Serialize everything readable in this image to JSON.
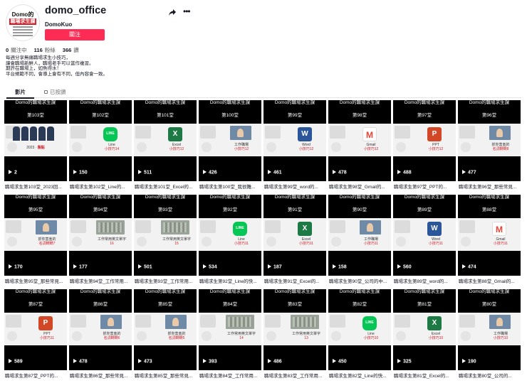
{
  "profile": {
    "username": "domo_office",
    "nickname": "DomoKuo",
    "follow_label": "關注",
    "avatar_title": "Domo的",
    "avatar_subtitle": "職場求生課"
  },
  "stats": [
    {
      "value": "0",
      "label": "關注中"
    },
    {
      "value": "116",
      "label": "粉絲"
    },
    {
      "value": "366",
      "label": "讚"
    }
  ],
  "bio": [
    "每週分享無痛職場求生小技巧，",
    "讓會職場新鮮人，職場老手可以當作複習。",
    "期許在職場上，如魚得水！",
    "平台規範不同，會導上會有不同，但內容會一致。"
  ],
  "tabs": {
    "videos": "影片",
    "liked": "已按讚"
  },
  "icon_names": {
    "share": "share-icon",
    "more": "more-icon",
    "play": "play-icon",
    "lock": "lock-icon"
  },
  "colors": {
    "follow": "#fe2c55",
    "accent_red": "#d2202a"
  },
  "brand": "Domo的職場求生課",
  "videos": [
    {
      "ep": "第103堂",
      "views": "2",
      "icon": "group",
      "label": "2023",
      "label2": "盤點",
      "caption": "職場求生第103堂_2023回..."
    },
    {
      "ep": "第102堂",
      "views": "150",
      "icon": "line",
      "label": "Line",
      "label2": "小技巧14",
      "caption": "職場求生第102堂_Line的..."
    },
    {
      "ep": "第101堂",
      "views": "511",
      "icon": "excel",
      "label": "Excel",
      "label2": "小技巧12",
      "caption": "職場求生第101堂_Excel的..."
    },
    {
      "ep": "第100堂",
      "views": "426",
      "icon": "photo",
      "label": "工作職場",
      "label2": "小技巧12",
      "caption": "職場求生第100堂_我很難..."
    },
    {
      "ep": "第99堂",
      "views": "461",
      "icon": "word",
      "label": "Word",
      "label2": "小技巧12",
      "caption": "職場求生第99堂_word的..."
    },
    {
      "ep": "第98堂",
      "views": "478",
      "icon": "gmail",
      "label": "Gmail",
      "label2": "小技巧12",
      "caption": "職場求生第98堂_Gmail的..."
    },
    {
      "ep": "第97堂",
      "views": "488",
      "icon": "ppt",
      "label": "PPT",
      "label2": "小技巧12",
      "caption": "職場求生第97堂_PPT的..."
    },
    {
      "ep": "第96堂",
      "views": "477",
      "icon": "photo",
      "label": "抓你害羞的",
      "label2": "名詞轉轉8",
      "caption": "職場求生第96堂_那些常見..."
    },
    {
      "ep": "第95堂",
      "views": "170",
      "icon": "photo",
      "label": "抓你害羞的",
      "label2": "名詞轉轉7",
      "caption": "職場求生第95堂_那些常見..."
    },
    {
      "ep": "第94堂",
      "views": "177",
      "icon": "office",
      "label": "工作常用英文單字",
      "label2": "16",
      "caption": "職場求生第94堂_工作常用..."
    },
    {
      "ep": "第93堂",
      "views": "501",
      "icon": "office",
      "label": "工作常用英文單字",
      "label2": "15",
      "caption": "職場求生第93堂_工作常用..."
    },
    {
      "ep": "第92堂",
      "views": "534",
      "icon": "line",
      "label": "Line",
      "label2": "小技巧11",
      "caption": "職場求生第92堂_Line的快..."
    },
    {
      "ep": "第91堂",
      "views": "187",
      "icon": "excel",
      "label": "Excel",
      "label2": "小技巧11",
      "caption": "職場求生第91堂_Excel的..."
    },
    {
      "ep": "第90堂",
      "views": "158",
      "icon": "photo",
      "label": "工作職場",
      "label2": "小技巧11",
      "caption": "職場求生第90堂_公司的中..."
    },
    {
      "ep": "第89堂",
      "views": "560",
      "icon": "word",
      "label": "Word",
      "label2": "小技巧11",
      "caption": "職場求生第89堂_word的..."
    },
    {
      "ep": "第88堂",
      "views": "474",
      "icon": "gmail",
      "label": "Gmail",
      "label2": "小技巧11",
      "caption": "職場求生第88堂_Gmail的..."
    },
    {
      "ep": "第87堂",
      "views": "589",
      "icon": "ppt",
      "label": "PPT",
      "label2": "小技巧11",
      "caption": "職場求生第87堂_PPT的..."
    },
    {
      "ep": "第86堂",
      "views": "478",
      "icon": "photo",
      "label": "抓你害羞的",
      "label2": "名詞轉轉6",
      "caption": "職場求生第86堂_那些常見..."
    },
    {
      "ep": "第85堂",
      "views": "473",
      "icon": "photo",
      "label": "抓你害羞的",
      "label2": "名詞轉轉5",
      "caption": "職場求生第85堂_那些常見..."
    },
    {
      "ep": "第84堂",
      "views": "393",
      "icon": "office",
      "label": "工作常用英文單字",
      "label2": "14",
      "caption": "職場求生第84堂_工作常用..."
    },
    {
      "ep": "第83堂",
      "views": "486",
      "icon": "office",
      "label": "工作常用英文單字",
      "label2": "13",
      "caption": "職場求生第83堂_工作常用..."
    },
    {
      "ep": "第82堂",
      "views": "450",
      "icon": "line",
      "label": "Line",
      "label2": "小技巧10",
      "caption": "職場求生第82堂_Line的快..."
    },
    {
      "ep": "第81堂",
      "views": "325",
      "icon": "excel",
      "label": "Excel",
      "label2": "小技巧10",
      "caption": "職場求生第81堂_Excel的..."
    },
    {
      "ep": "第80堂",
      "views": "190",
      "icon": "photo",
      "label": "工作職場",
      "label2": "小技巧10",
      "caption": "職場求生第80堂_公司的..."
    }
  ]
}
